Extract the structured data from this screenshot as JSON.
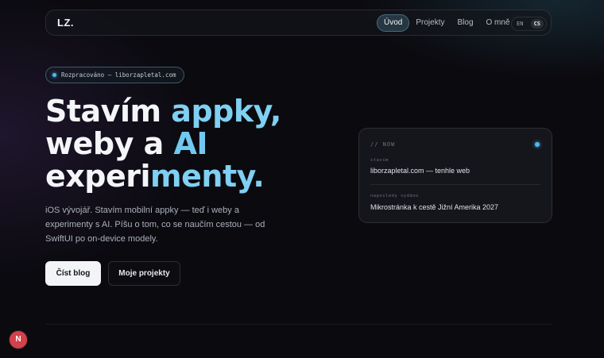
{
  "header": {
    "logo": "LZ.",
    "nav": [
      {
        "label": "Úvod",
        "active": true
      },
      {
        "label": "Projekty",
        "active": false
      },
      {
        "label": "Blog",
        "active": false
      },
      {
        "label": "O mně",
        "active": false
      }
    ],
    "lang": {
      "options": [
        "EN",
        "CS"
      ],
      "selected": "CS"
    }
  },
  "hero": {
    "status_pill": "Rozpracováno — liborzapletal.com",
    "headline": {
      "line1_plain": "Stavím ",
      "line1_accent": "appky,",
      "line2_plain": "weby a ",
      "line2_accent": "AI",
      "line3_plain": "experi",
      "line3_accent": "menty."
    },
    "description": "iOS vývojář. Stavím mobilní appky — teď i weby a experimenty s AI. Píšu o tom, co se naučím cestou — od SwiftUI po on-device modely.",
    "primary_button": "Číst blog",
    "secondary_button": "Moje projekty"
  },
  "now_card": {
    "heading": "// NOW",
    "rows": [
      {
        "label": "stavím",
        "value": "liborzapletal.com — tenhle web"
      },
      {
        "label": "naposledy vydáno",
        "value": "Mikrostránka k cestě Jižní Amerika 2027"
      }
    ]
  },
  "floating_badge": "N",
  "colors": {
    "accent": "#4db8f0",
    "badge": "#d6404a",
    "background": "#0b0a0f"
  }
}
